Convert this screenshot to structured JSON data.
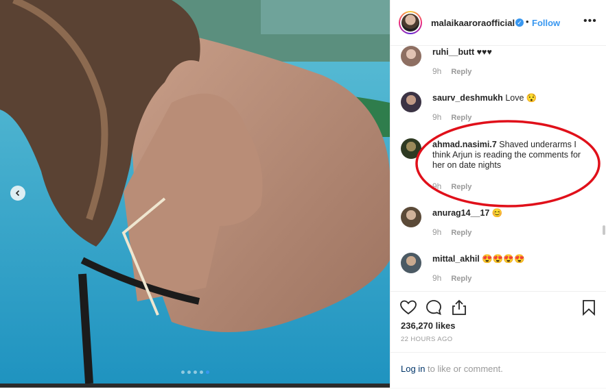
{
  "post": {
    "username": "malaikaaroraofficial",
    "separator": "•",
    "follow_label": "Follow",
    "more_label": "•••",
    "verified_icon": "verified-badge-icon",
    "carousel": {
      "dots_total": 5,
      "active_index": 4
    }
  },
  "comments": [
    {
      "user": "ruhi__butt",
      "text": "♥♥♥",
      "time": "9h",
      "reply": "Reply"
    },
    {
      "user": "saurv_deshmukh",
      "text": "Love 😯",
      "time": "9h",
      "reply": "Reply"
    },
    {
      "user": "ahmad.nasimi.7",
      "text": "Shaved underarms I think Arjun is reading the comments for her on date nights",
      "time": "9h",
      "reply": "Reply"
    },
    {
      "user": "anurag14__17",
      "text": "😊",
      "time": "9h",
      "reply": "Reply"
    },
    {
      "user": "mittal_akhil",
      "text": "😍😍😍😍",
      "time": "9h",
      "reply": "Reply"
    }
  ],
  "footer": {
    "likes": "236,270 likes",
    "time": "22 HOURS AGO",
    "login_link": "Log in",
    "login_rest": " to like or comment."
  },
  "colors": {
    "accent": "#3897f0",
    "annotation": "#e0101a"
  }
}
